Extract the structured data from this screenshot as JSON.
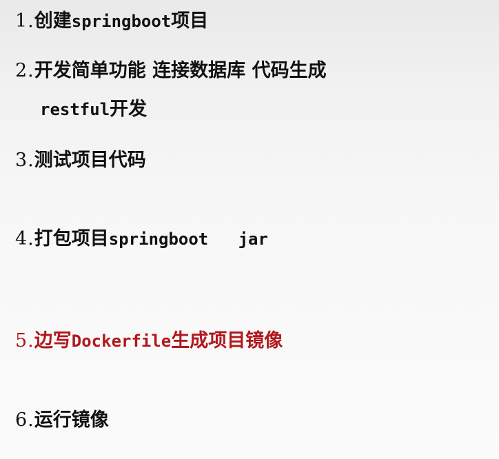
{
  "steps": [
    {
      "number": "1.",
      "text_cn": "创建",
      "text_en": "springboot",
      "text_cn2": "项目"
    },
    {
      "number": "2.",
      "text": "开发简单功能 连接数据库 代码生成",
      "continuation_en": "restful",
      "continuation_cn": "开发"
    },
    {
      "number": "3.",
      "text": "测试项目代码"
    },
    {
      "number": "4.",
      "text_cn": "打包项目",
      "text_en": "springboot   jar"
    },
    {
      "number": "5.",
      "text_cn": "边写",
      "text_en": "Dockerfile",
      "text_cn2": "生成项目镜像",
      "color": "#b0181c"
    },
    {
      "number": "6.",
      "text": "运行镜像"
    }
  ],
  "colors": {
    "text": "#111111",
    "highlight": "#b0181c"
  }
}
